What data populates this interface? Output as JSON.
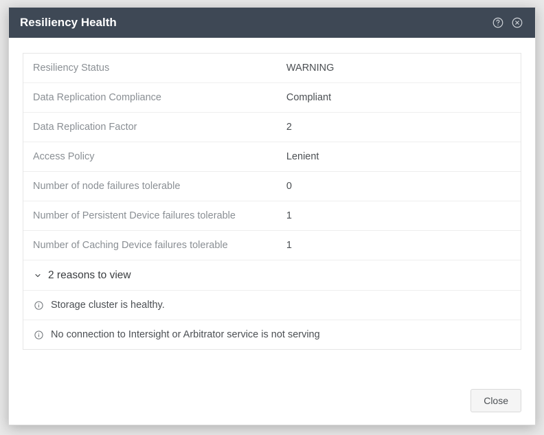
{
  "modal": {
    "title": "Resiliency Health",
    "close_label": "Close"
  },
  "rows": [
    {
      "label": "Resiliency Status",
      "value": "WARNING"
    },
    {
      "label": "Data Replication Compliance",
      "value": "Compliant"
    },
    {
      "label": "Data Replication Factor",
      "value": "2"
    },
    {
      "label": "Access Policy",
      "value": "Lenient"
    },
    {
      "label": "Number of node failures tolerable",
      "value": "0"
    },
    {
      "label": "Number of Persistent Device failures tolerable",
      "value": "1"
    },
    {
      "label": "Number of Caching Device failures tolerable",
      "value": "1"
    }
  ],
  "expander": {
    "label": "2 reasons to view"
  },
  "reasons": [
    "Storage cluster is healthy.",
    "No connection to Intersight or Arbitrator service is not serving"
  ]
}
